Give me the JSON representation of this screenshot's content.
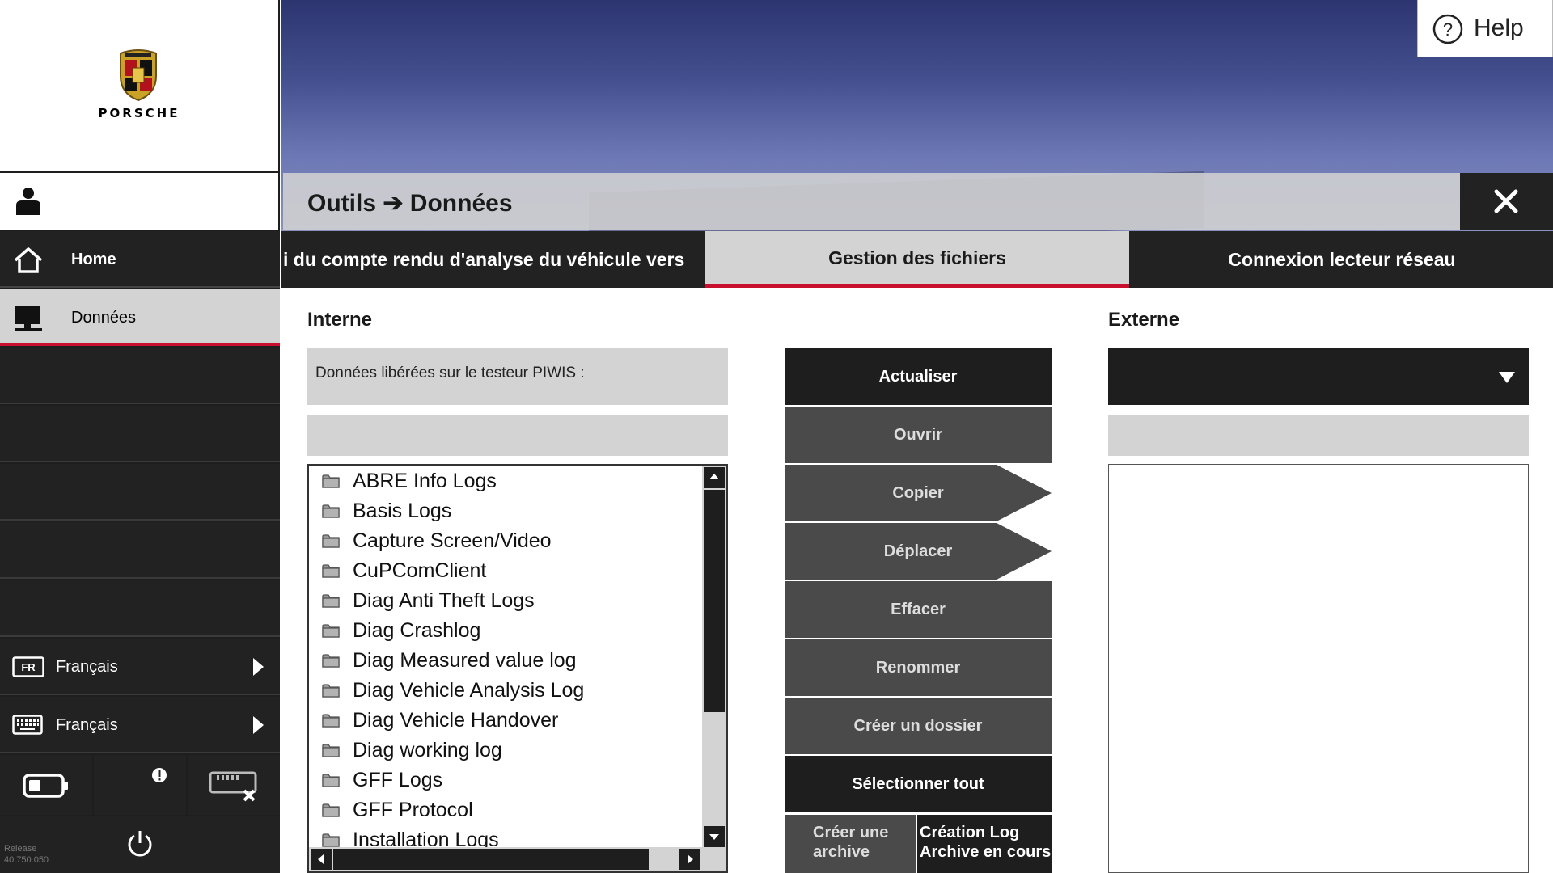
{
  "brand": {
    "name": "PORSCHE"
  },
  "help": {
    "label": "Help"
  },
  "header": {
    "title": "Outils ➔ Données"
  },
  "sidebar": {
    "items": [
      {
        "label": "Home",
        "icon": "home-icon"
      },
      {
        "label": "Données",
        "icon": "folder-computer-icon"
      }
    ],
    "language": {
      "badge": "FR",
      "label": "Français"
    },
    "keyboard": {
      "label": "Français"
    },
    "release": {
      "line1": "Release",
      "line2": "40.750.050"
    }
  },
  "tabs": [
    {
      "label": "i du compte rendu d'analyse du véhicule vers"
    },
    {
      "label": "Gestion des fichiers"
    },
    {
      "label": "Connexion lecteur réseau"
    }
  ],
  "internal": {
    "title": "Interne",
    "info": "Données libérées sur le testeur PIWIS :",
    "files": [
      "ABRE Info Logs",
      "Basis Logs",
      "Capture Screen/Video",
      "CuPComClient",
      "Diag Anti Theft Logs",
      "Diag Crashlog",
      "Diag Measured value log",
      "Diag Vehicle Analysis Log",
      "Diag Vehicle Handover",
      "Diag working log",
      "GFF Logs",
      "GFF Protocol",
      "Installation Logs"
    ]
  },
  "actions": {
    "refresh": "Actualiser",
    "open": "Ouvrir",
    "copy": "Copier",
    "move": "Déplacer",
    "delete": "Effacer",
    "rename": "Renommer",
    "create_folder": "Créer un dossier",
    "select_all": "Sélectionner tout",
    "create_archive_l1": "Créer une",
    "create_archive_l2": "archive",
    "log_archive_l1": "Création Log",
    "log_archive_l2": "Archive en cours"
  },
  "external": {
    "title": "Externe"
  },
  "colors": {
    "accent": "#c8102e",
    "dark": "#1e1e1e",
    "panel_gray": "#d3d3d3",
    "button_gray": "#4a4a4a"
  }
}
